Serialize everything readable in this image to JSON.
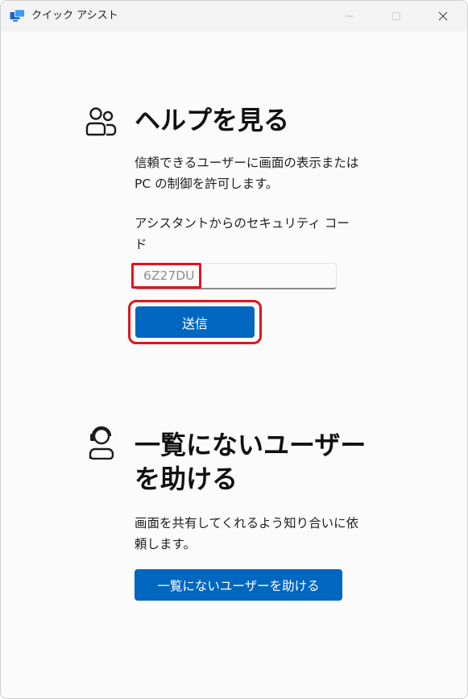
{
  "window": {
    "title": "クイック アシスト",
    "app_icon": "quick-assist-icon",
    "controls": [
      "minimize-icon",
      "maximize-icon",
      "close-icon"
    ]
  },
  "get_help": {
    "icon": "people-icon",
    "heading": "ヘルプを見る",
    "description_line1": "信頼できるユーザーに画面の表示または",
    "description_line2": "PC の制御を許可します。",
    "code_label_line1": "アシスタントからのセキュリティ コー",
    "code_label_line2": "ド",
    "code_value": "6Z27DU",
    "submit_label": "送信"
  },
  "help_someone": {
    "icon": "person-headset-icon",
    "heading_line1": "一覧にないユーザー",
    "heading_line2": "を助ける",
    "description_line1": "画面を共有してくれるよう知り合いに依",
    "description_line2": "頼します。",
    "button_label": "一覧にないユーザーを助ける"
  },
  "colors": {
    "accent": "#0067c0",
    "highlight": "#e1141f"
  }
}
